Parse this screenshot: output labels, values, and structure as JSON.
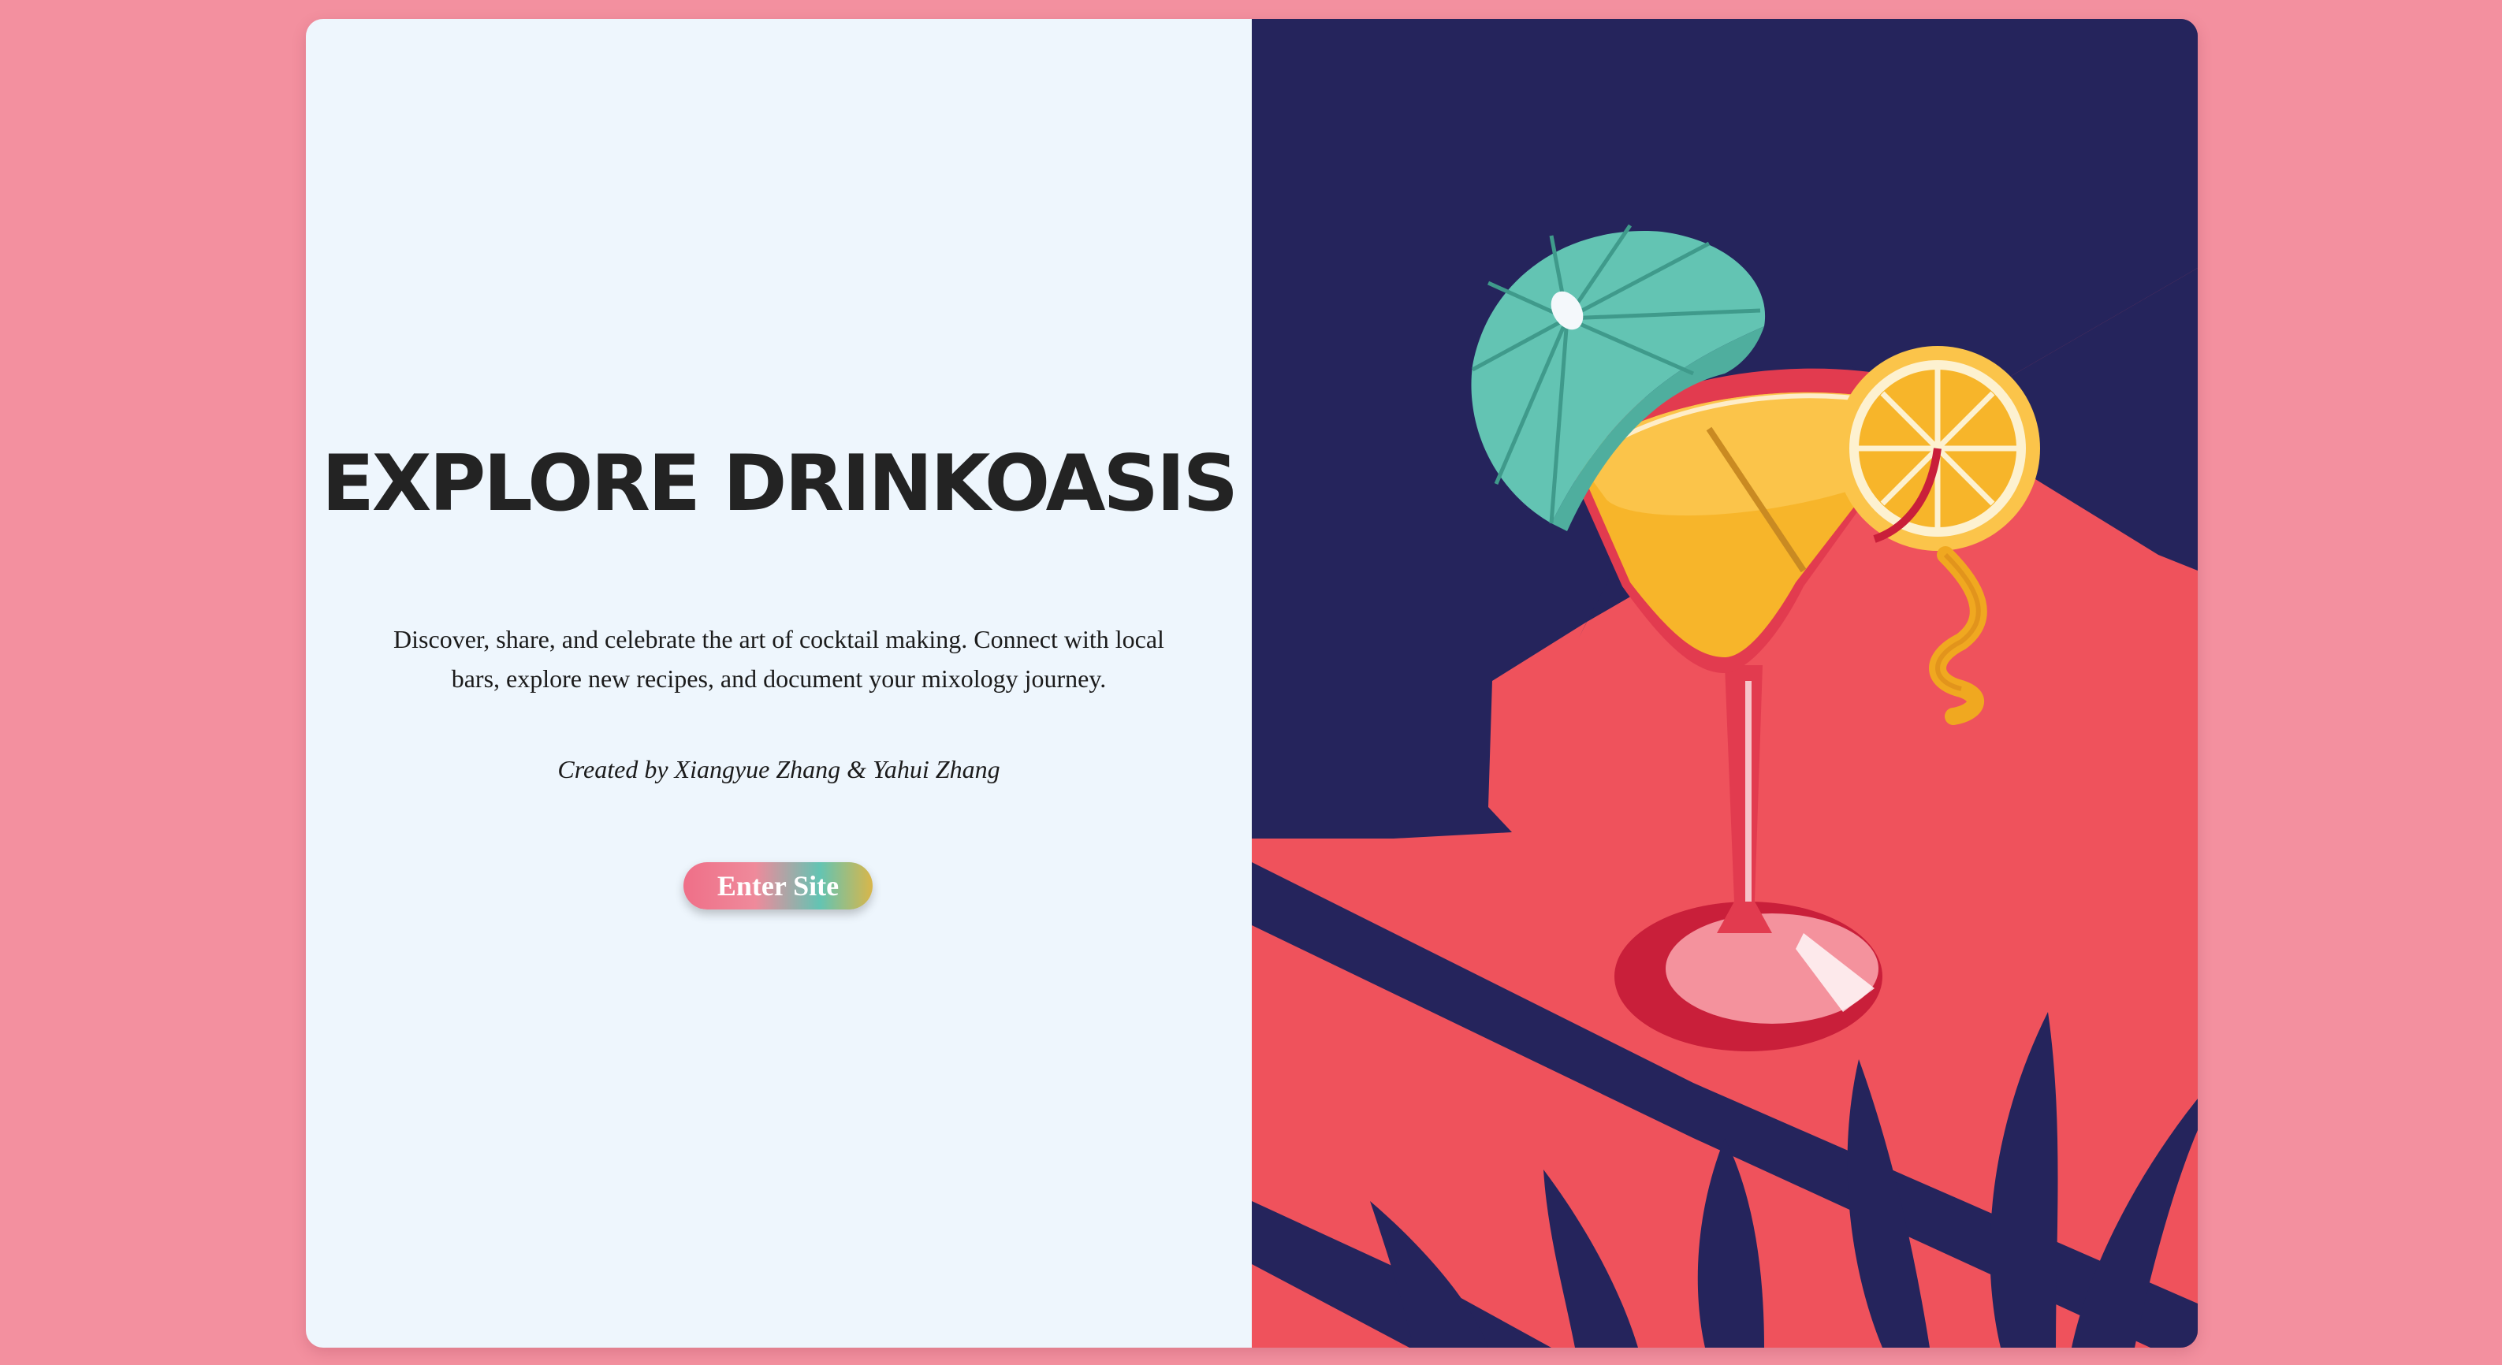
{
  "landing": {
    "title": "EXPLORE DRINKOASIS",
    "description": "Discover, share, and celebrate the art of cocktail making. Connect with local bars, explore new recipes, and document your mixology journey.",
    "credit": "Created by Xiangyue Zhang & Yahui Zhang",
    "enter_label": "Enter Site"
  },
  "colors": {
    "page_background": "#f3909f",
    "left_panel": "#eef6fd",
    "night_sky": "#25245c",
    "table_red": "#ef525c",
    "umbrella_teal": "#63c4b3",
    "orange": "#f7b52a"
  },
  "illustration": {
    "subject": "cocktail-glass-with-umbrella-and-orange-slice"
  }
}
